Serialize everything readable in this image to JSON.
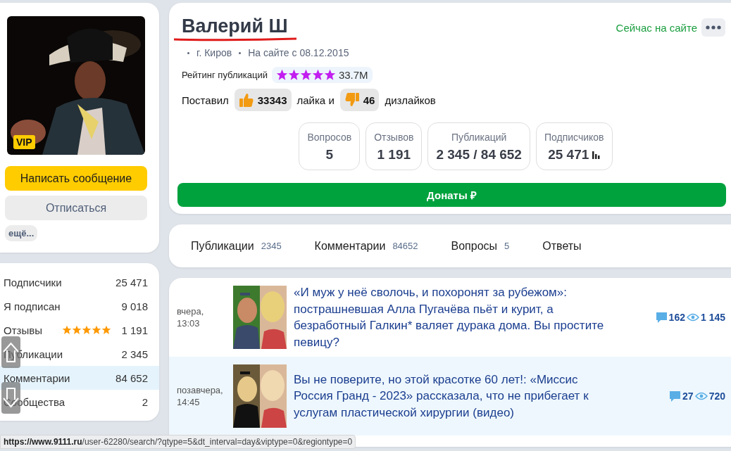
{
  "profile": {
    "badge": "VIP",
    "buttons": [
      {
        "label": "Написать сообщение",
        "kind": "primary"
      },
      {
        "label": "Отписаться",
        "kind": "secondary"
      }
    ],
    "more": "ещё..."
  },
  "stats": [
    {
      "label": "Подписчики",
      "value": "25 471",
      "selected": false
    },
    {
      "label": "Я подписан",
      "value": "9 018",
      "selected": false
    },
    {
      "label": "Отзывы",
      "value": "1 191",
      "stars": 5,
      "selected": false
    },
    {
      "label": "Публикации",
      "value": "2 345",
      "selected": false
    },
    {
      "label": "Комментарии",
      "value": "84 652",
      "selected": true
    },
    {
      "label": "Сообщества",
      "value": "2",
      "selected": false
    }
  ],
  "header": {
    "name": "Валерий Ш",
    "status": "Сейчас на сайте",
    "location": "г. Киров",
    "since": "На сайте с 08.12.2015",
    "rating": {
      "label": "Рейтинг публикаций",
      "stars": 5,
      "value": "33.7M"
    },
    "likes": {
      "prefix": "Поставил",
      "likes": "33343",
      "middle": "лайка и",
      "dislikes": "46",
      "suffix": "дизлайков"
    },
    "counters": [
      {
        "label": "Вопросов",
        "value": "5",
        "kind": "plain"
      },
      {
        "label": "Отзывов",
        "value": "1 191",
        "kind": "plain"
      },
      {
        "label": "Публикаций",
        "value": "2 345 / 84 652",
        "kind": "plain"
      },
      {
        "label": "Подписчиков",
        "value": "25 471",
        "kind": "chart"
      }
    ],
    "donate": "Донаты ₽"
  },
  "tabs": [
    {
      "label": "Публикации",
      "count": "2345",
      "selected": false
    },
    {
      "label": "Комментарии",
      "count": "84652",
      "selected": false
    },
    {
      "label": "Вопросы",
      "count": "5",
      "selected": false
    },
    {
      "label": "Ответы",
      "selected": false
    }
  ],
  "feed": [
    {
      "date": "вчера,",
      "time": "13:03",
      "title": "«И муж у неё сволочь, и похоронят за рубежом»: пострашневшая Алла Пугачёва пьёт и курит, а безработный Галкин* валяет дурака дома. Вы простите певицу?",
      "comments": "162",
      "views": "1 145",
      "selected": false,
      "kind": "picture"
    },
    {
      "date": "позавчера,",
      "time": "14:45",
      "title": "Вы не поверите, но этой красотке 60 лет!: «Миссис Россия Гранд - 2023» рассказала, что не прибегает к услугам пластической хирургии (видео)",
      "comments": "27",
      "views": "720",
      "selected": true,
      "kind": "picture"
    }
  ],
  "status_bar": {
    "url": "**https://www.9111.ru**/user-62280/search/?qtype=5&dt_interval=day&viptype=0&regiontype=0"
  }
}
